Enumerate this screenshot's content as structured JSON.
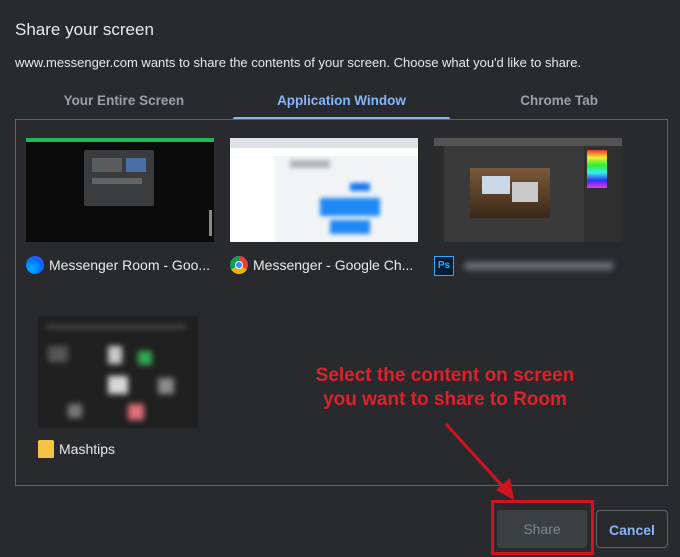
{
  "dialog": {
    "title": "Share your screen",
    "subtitle": "www.messenger.com wants to share the contents of your screen. Choose what you'd like to share."
  },
  "tabs": [
    {
      "label": "Your Entire Screen",
      "active": false
    },
    {
      "label": "Application Window",
      "active": true
    },
    {
      "label": "Chrome Tab",
      "active": false
    }
  ],
  "windows": [
    {
      "label": "Messenger Room - Goo...",
      "icon": "messenger-icon",
      "icon_color": "#1877f2"
    },
    {
      "label": "Messenger - Google Ch...",
      "icon": "chrome-icon",
      "icon_color": "#4285f4"
    },
    {
      "label": "",
      "icon": "photoshop-icon",
      "icon_color": "#31a8ff"
    },
    {
      "label": "Mashtips",
      "icon": "folder-icon",
      "icon_color": "#f6c343"
    }
  ],
  "annotation": {
    "line1": "Select the content on screen",
    "line2": "you want to share to Room",
    "color": "#e0202a"
  },
  "buttons": {
    "share_label": "Share",
    "cancel_label": "Cancel"
  },
  "colors": {
    "background": "#292a2d",
    "accent": "#8ab4f8",
    "highlight": "#d3121f"
  }
}
